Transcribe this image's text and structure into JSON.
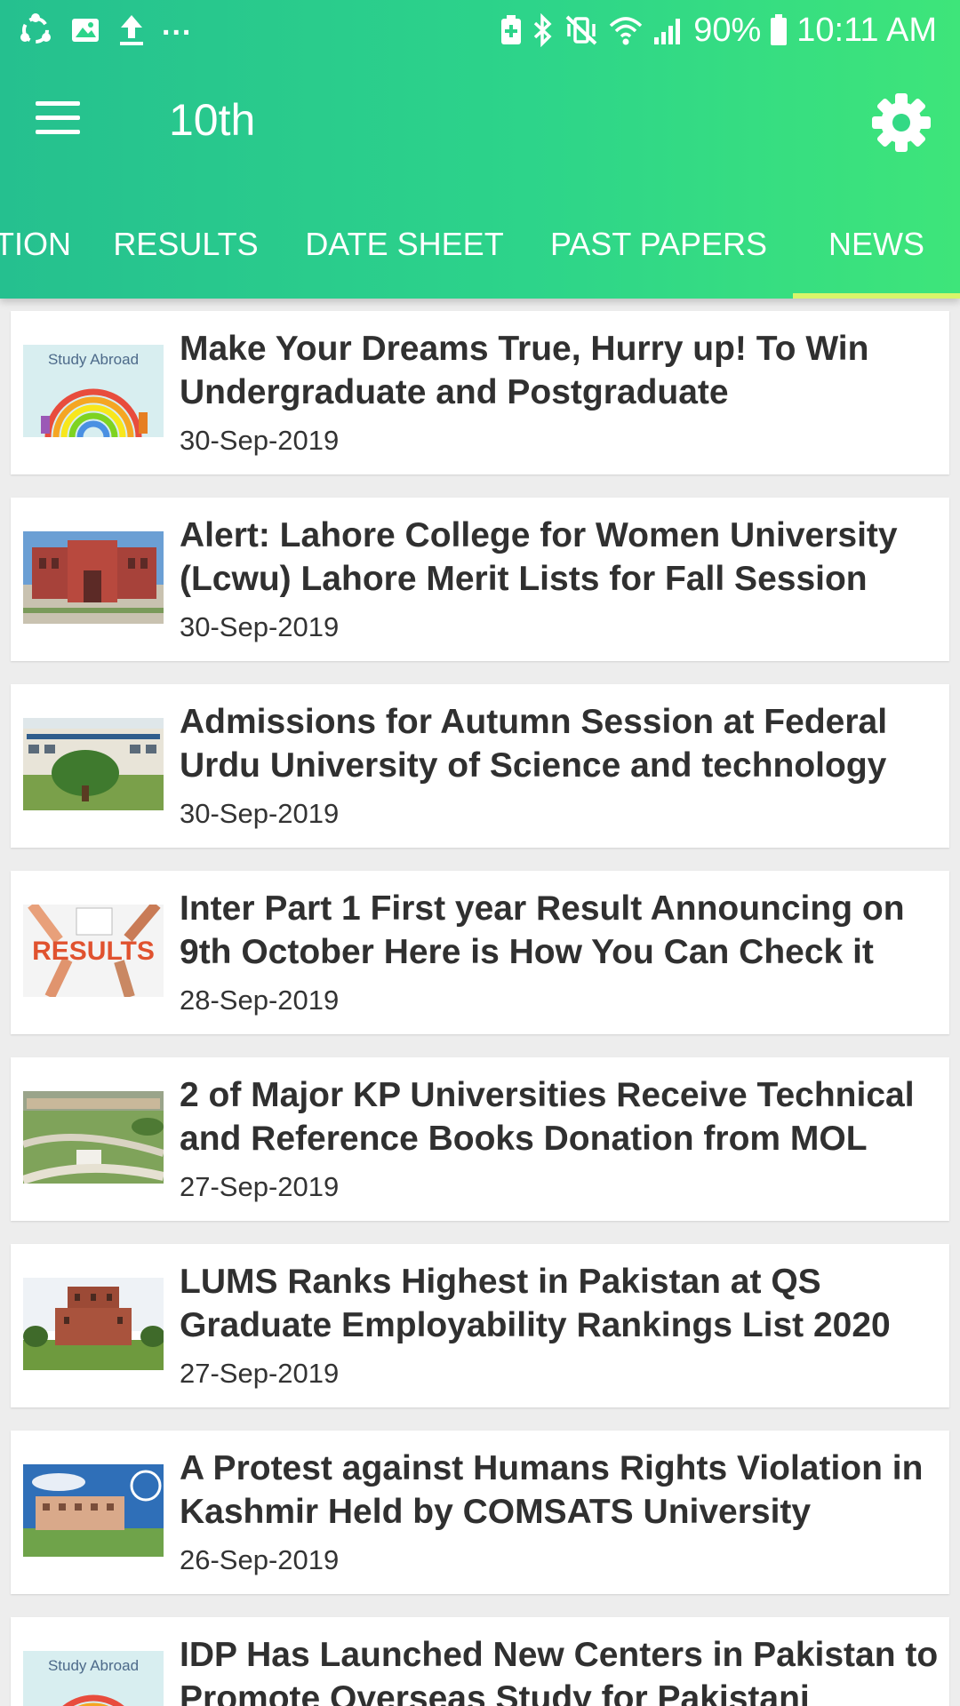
{
  "status_bar": {
    "battery": "90%",
    "time": "10:11 AM",
    "dots": "..."
  },
  "toolbar": {
    "title": "10th",
    "accent_color": "#2dd48a",
    "indicator_color": "#d8f56a"
  },
  "tabs": [
    {
      "label": "TION",
      "active": false
    },
    {
      "label": "RESULTS",
      "active": false
    },
    {
      "label": "DATE SHEET",
      "active": false
    },
    {
      "label": "PAST PAPERS",
      "active": false
    },
    {
      "label": "NEWS",
      "active": true
    }
  ],
  "news": [
    {
      "title": "Make Your Dreams True, Hurry up! To Win Undergraduate and Postgraduate",
      "date": "30-Sep-2019",
      "thumb": "study-abroad",
      "thumb_label": "Study Abroad"
    },
    {
      "title": "Alert: Lahore College for Women University (Lcwu) Lahore Merit Lists for Fall Session",
      "date": "30-Sep-2019",
      "thumb": "college-building"
    },
    {
      "title": "Admissions for Autumn Session at Federal Urdu University of Science and technology",
      "date": "30-Sep-2019",
      "thumb": "university-campus"
    },
    {
      "title": "Inter Part 1 First year Result Announcing on 9th October Here is How You Can Check it",
      "date": "28-Sep-2019",
      "thumb": "results",
      "thumb_label": "RESULTS"
    },
    {
      "title": "2 of Major KP Universities Receive Technical and Reference Books Donation from MOL",
      "date": "27-Sep-2019",
      "thumb": "aerial-campus"
    },
    {
      "title": "LUMS Ranks Highest in Pakistan at QS Graduate Employability Rankings List 2020",
      "date": "27-Sep-2019",
      "thumb": "brick-building"
    },
    {
      "title": "A Protest against Humans Rights Violation in Kashmir Held by COMSATS University",
      "date": "26-Sep-2019",
      "thumb": "comsats-campus"
    },
    {
      "title": "IDP Has Launched New Centers in Pakistan to Promote Overseas Study for Pakistani",
      "date": "",
      "thumb": "study-abroad",
      "thumb_label": "Study Abroad"
    }
  ]
}
